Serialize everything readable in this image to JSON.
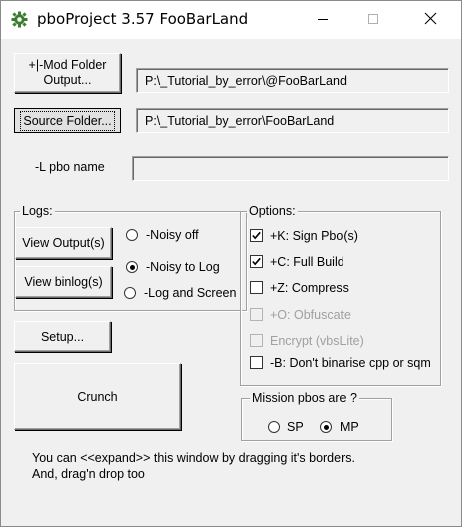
{
  "window": {
    "title": "pboProject 3.57 FooBarLand"
  },
  "titlebar_icons": {
    "app": "gear-icon",
    "minimize": "minimize-icon",
    "maximize": "maximize-icon",
    "close": "close-icon"
  },
  "paths": {
    "mod_folder_button": "+|-Mod Folder\nOutput...",
    "mod_folder_value": "P:\\_Tutorial_by_error\\@FooBarLand",
    "source_folder_button": "Source Folder...",
    "source_folder_value": "P:\\_Tutorial_by_error\\FooBarLand",
    "pbo_name_label": "-L pbo name",
    "pbo_name_value": ""
  },
  "logs": {
    "title": "Logs:",
    "view_output_button": "View Output(s)",
    "view_binlog_button": "View binlog(s)",
    "radios": [
      {
        "label": "-Noisy off",
        "checked": false
      },
      {
        "label": "-Noisy to Log",
        "checked": true
      },
      {
        "label": "-Log and Screen",
        "checked": false
      }
    ]
  },
  "options": {
    "title": "Options:",
    "items": [
      {
        "label": "+K: Sign Pbo(s)",
        "checked": true,
        "enabled": true
      },
      {
        "label": "+C: Full Build",
        "checked": true,
        "enabled": true
      },
      {
        "label": "+Z: Compress",
        "checked": false,
        "enabled": true
      },
      {
        "label": "+O: Obfuscate",
        "checked": false,
        "enabled": false
      },
      {
        "label": "Encrypt (vbsLite)",
        "checked": false,
        "enabled": false
      },
      {
        "label": "-B: Don't binarise cpp or sqm",
        "checked": false,
        "enabled": true
      }
    ]
  },
  "actions": {
    "setup_button": "Setup...",
    "crunch_button": "Crunch"
  },
  "mission": {
    "title": "Mission pbos are ?",
    "radios": [
      {
        "label": "SP",
        "checked": false
      },
      {
        "label": "MP",
        "checked": true
      }
    ]
  },
  "hints": {
    "line1": "You can <<expand>> this window by dragging it's borders.",
    "line2": "And, drag'n drop too"
  }
}
